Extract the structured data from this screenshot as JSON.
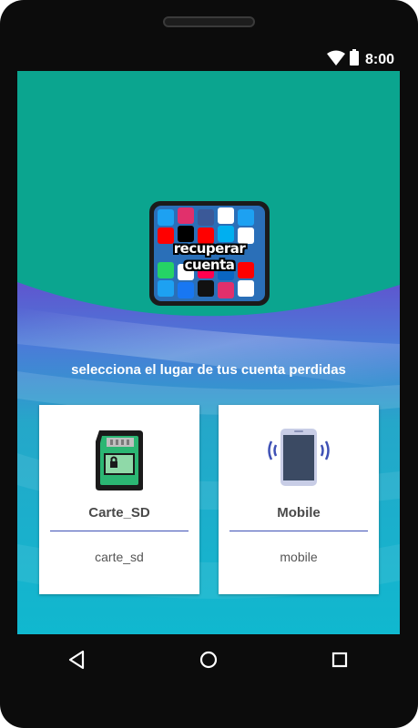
{
  "status_bar": {
    "time": "8:00",
    "icons": [
      "wifi-icon",
      "battery-icon"
    ]
  },
  "app_logo": {
    "caption": "recuperar cuenta"
  },
  "prompt": "selecciona el lugar de tus cuenta perdidas",
  "options": [
    {
      "icon": "sd-card-icon",
      "title": "Carte_SD",
      "value": "carte_sd"
    },
    {
      "icon": "smartphone-icon",
      "title": "Mobile",
      "value": "mobile"
    }
  ],
  "nav_bar": {
    "buttons": [
      "back-icon",
      "home-icon",
      "recents-icon"
    ]
  },
  "colors": {
    "teal": "#0ba58f",
    "cyan": "#12b7cc",
    "purple_wave": "#5e5ad1",
    "divider": "#3f51b5"
  }
}
